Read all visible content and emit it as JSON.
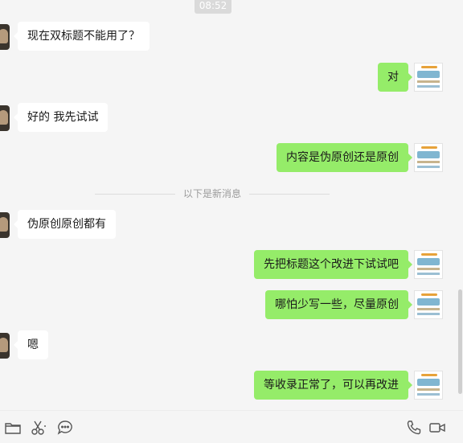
{
  "timestamp": "08:52",
  "divider_text": "以下是新消息",
  "messages": [
    {
      "side": "in",
      "text": "现在双标题不能用了？"
    },
    {
      "side": "out",
      "text": "对"
    },
    {
      "side": "in",
      "text": "好的 我先试试"
    },
    {
      "side": "out",
      "text": "内容是伪原创还是原创"
    },
    {
      "side": "in",
      "text": "伪原创原创都有"
    },
    {
      "side": "out",
      "text": "先把标题这个改进下试试吧"
    },
    {
      "side": "out",
      "text": "哪怕少写一些，尽量原创"
    },
    {
      "side": "in",
      "text": "嗯"
    },
    {
      "side": "out",
      "text": "等收录正常了，可以再改进"
    }
  ],
  "toolbar": {
    "left": [
      "folder-icon",
      "scissors-icon",
      "emoji-icon"
    ],
    "right": [
      "phone-icon",
      "video-call-icon"
    ]
  },
  "colors": {
    "background": "#f5f5f5",
    "incoming_bubble": "#ffffff",
    "outgoing_bubble": "#95ec69"
  }
}
